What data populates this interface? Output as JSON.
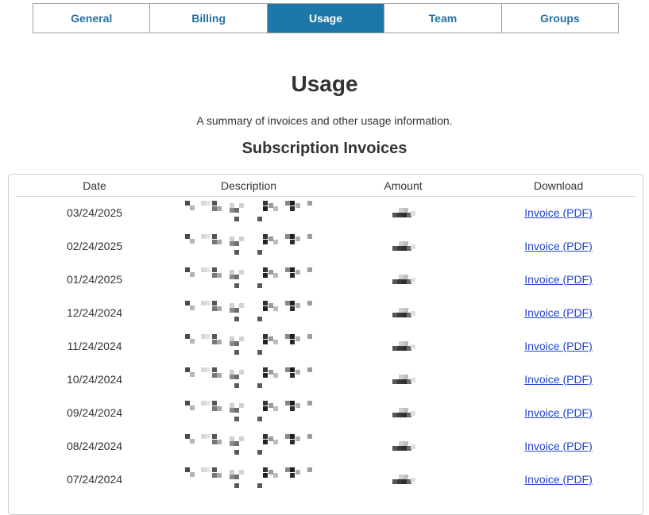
{
  "tabs": [
    {
      "label": "General",
      "active": false
    },
    {
      "label": "Billing",
      "active": false
    },
    {
      "label": "Usage",
      "active": true
    },
    {
      "label": "Team",
      "active": false
    },
    {
      "label": "Groups",
      "active": false
    }
  ],
  "page": {
    "title": "Usage",
    "subtitle": "A summary of invoices and other usage information."
  },
  "invoices": {
    "section_title": "Subscription Invoices",
    "columns": {
      "date": "Date",
      "description": "Description",
      "amount": "Amount",
      "download": "Download"
    },
    "rows": [
      {
        "date": "03/24/2025",
        "download_label": "Invoice (PDF)"
      },
      {
        "date": "02/24/2025",
        "download_label": "Invoice (PDF)"
      },
      {
        "date": "01/24/2025",
        "download_label": "Invoice (PDF)"
      },
      {
        "date": "12/24/2024",
        "download_label": "Invoice (PDF)"
      },
      {
        "date": "11/24/2024",
        "download_label": "Invoice (PDF)"
      },
      {
        "date": "10/24/2024",
        "download_label": "Invoice (PDF)"
      },
      {
        "date": "09/24/2024",
        "download_label": "Invoice (PDF)"
      },
      {
        "date": "08/24/2024",
        "download_label": "Invoice (PDF)"
      },
      {
        "date": "07/24/2024",
        "download_label": "Invoice (PDF)"
      }
    ]
  },
  "colors": {
    "tab_active_bg": "#1d77a8",
    "tab_text": "#2472a4",
    "link": "#2244cc"
  }
}
